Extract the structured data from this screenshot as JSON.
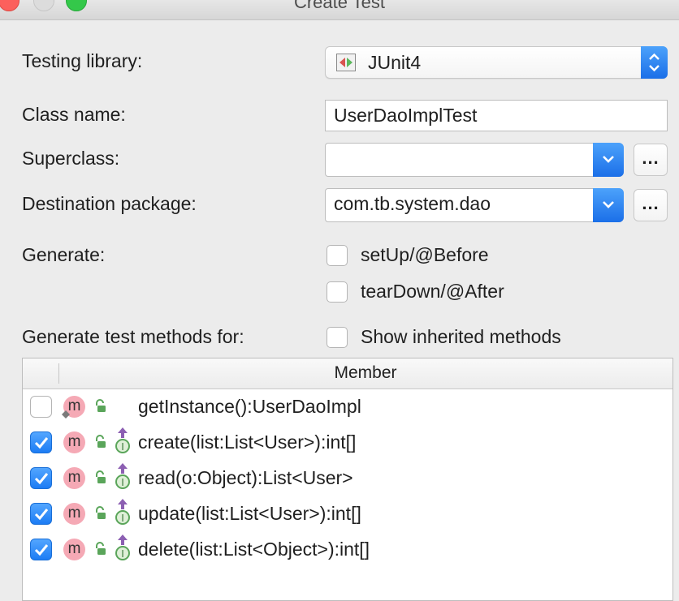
{
  "window": {
    "title": "Create Test"
  },
  "form": {
    "testing_library_label": "Testing library:",
    "testing_library_value": "JUnit4",
    "class_name_label": "Class name:",
    "class_name_value": "UserDaoImplTest",
    "superclass_label": "Superclass:",
    "superclass_value": "",
    "destination_label": "Destination package:",
    "destination_value": "com.tb.system.dao",
    "browse_label": "...",
    "generate_label": "Generate:",
    "setup_label": "setUp/@Before",
    "setup_checked": false,
    "teardown_label": "tearDown/@After",
    "teardown_checked": false,
    "methods_label": "Generate test methods for:",
    "inherited_label": "Show inherited methods",
    "inherited_checked": false
  },
  "table": {
    "header": "Member",
    "rows": [
      {
        "icon": "m",
        "checked": false,
        "name": "getInstance():UserDaoImpl"
      },
      {
        "icon": "m",
        "checked": true,
        "name": "create(list:List<User>):int[]"
      },
      {
        "icon": "m",
        "checked": true,
        "name": "read(o:Object):List<User>"
      },
      {
        "icon": "m",
        "checked": true,
        "name": "update(list:List<User>):int[]"
      },
      {
        "icon": "m",
        "checked": true,
        "name": "delete(list:List<Object>):int[]"
      }
    ]
  },
  "colors": {
    "accent": "#1f7bf2",
    "method_icon": "#f5a9b5",
    "lock_green": "#5aa55a",
    "impl_purple": "#8c5fb2"
  }
}
